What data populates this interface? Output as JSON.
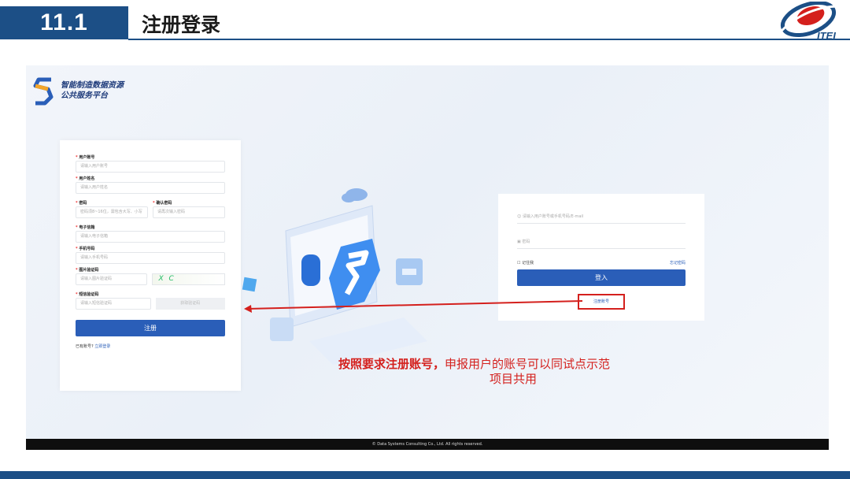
{
  "slide": {
    "section_number": "11.1",
    "section_title": "注册登录",
    "logo_text": "ITEI"
  },
  "platform": {
    "brand_line1": "智能制造数据资源",
    "brand_line2": "公共服务平台"
  },
  "register_form": {
    "username_label": "用户账号",
    "username_placeholder": "请输入用户账号",
    "name_label": "用户姓名",
    "name_placeholder": "请输入用户姓名",
    "password_label": "密码",
    "password_placeholder": "密码须8~16位，需包含大写、小写",
    "confirm_label": "确认密码",
    "confirm_placeholder": "请再次输入密码",
    "email_label": "电子信箱",
    "email_placeholder": "请输入电子信箱",
    "phone_label": "手机号码",
    "phone_placeholder": "请输入手机号码",
    "captcha_label": "图片验证码",
    "captcha_placeholder": "请输入图片验证码",
    "captcha_text": "X C",
    "sms_label": "短信验证码",
    "sms_placeholder": "请输入短信验证码",
    "sms_button": "获取验证码",
    "submit_label": "注册",
    "have_account": "已有账号?",
    "login_link": "立即登录",
    "required_mark": "*"
  },
  "login_form": {
    "account_placeholder": "请输入用户账号或手机号码/E-mail",
    "password_placeholder": "密码",
    "remember_label": "记住我",
    "forgot_label": "忘记密码",
    "login_button": "登入",
    "register_link": "注册账号"
  },
  "footer": {
    "copyright": "© Data Systems Consulting Co., Ltd. All rights reserved."
  },
  "annotation": {
    "bold_part": "按照要求注册账号，",
    "rest_line1": "申报用户的账号可以同试点示范",
    "line2": "项目共用"
  },
  "colors": {
    "brand_blue": "#1c4f86",
    "button_blue": "#2a5eb8",
    "highlight_red": "#d4201d"
  },
  "icons": [
    "user-icon",
    "lock-icon",
    "checkbox-icon",
    "cloud-icon",
    "platform-logo-icon",
    "itei-logo-icon"
  ]
}
